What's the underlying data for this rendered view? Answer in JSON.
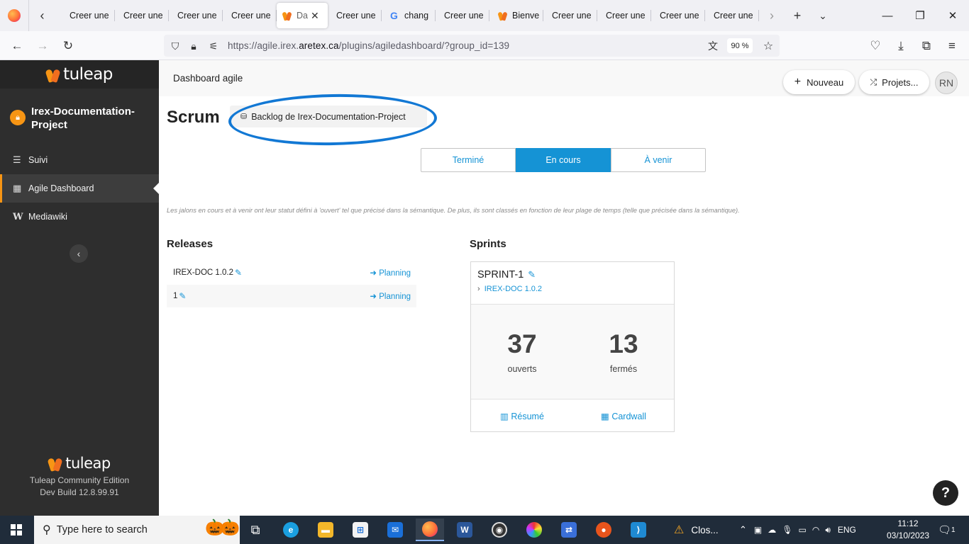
{
  "browser": {
    "tabs": [
      {
        "label": "Creer une",
        "favicon": "none"
      },
      {
        "label": "Creer une",
        "favicon": "none"
      },
      {
        "label": "Creer une",
        "favicon": "none"
      },
      {
        "label": "Creer une",
        "favicon": "none"
      },
      {
        "label": "Da",
        "favicon": "tuleap-icon",
        "active": true
      },
      {
        "label": "Creer une",
        "favicon": "none"
      },
      {
        "label": "chang",
        "favicon": "google-icon"
      },
      {
        "label": "Creer une",
        "favicon": "none"
      },
      {
        "label": "Bienve",
        "favicon": "tuleap-icon"
      },
      {
        "label": "Creer une",
        "favicon": "none"
      },
      {
        "label": "Creer une",
        "favicon": "none"
      },
      {
        "label": "Creer une",
        "favicon": "none"
      },
      {
        "label": "Creer une",
        "favicon": "none"
      }
    ],
    "url_prefix": "https://agile.irex.",
    "url_domain": "aretex.ca",
    "url_path": "/plugins/agiledashboard/?group_id=139",
    "zoom": "90 %"
  },
  "sidebar": {
    "logo_text": "tuleap",
    "project_name": "Irex-Documentation-Project",
    "items": [
      {
        "label": "Suivi",
        "icon": "list-icon"
      },
      {
        "label": "Agile Dashboard",
        "icon": "table-icon",
        "active": true
      },
      {
        "label": "Mediawiki",
        "icon": "wiki-icon"
      }
    ],
    "footer_logo": "tuleap",
    "edition": "Tuleap Community Edition",
    "build": "Dev Build 12.8.99.91"
  },
  "header": {
    "breadcrumb": "Dashboard agile",
    "new_button": "Nouveau",
    "projects_button": "Projets...",
    "avatar_initials": "RN"
  },
  "main": {
    "title": "Scrum",
    "backlog_button": "Backlog de Irex-Documentation-Project",
    "segments": [
      {
        "label": "Terminé"
      },
      {
        "label": "En cours",
        "active": true
      },
      {
        "label": "À venir"
      }
    ],
    "hint": "Les jalons en cours et à venir ont leur statut défini à 'ouvert' tel que précisé dans la sémantique. De plus, ils sont classés en fonction de leur plage de temps (telle que précisée dans la sémantique).",
    "releases_title": "Releases",
    "releases": [
      {
        "name": "IREX-DOC 1.0.2",
        "link": "Planning"
      },
      {
        "name": "1",
        "link": "Planning"
      }
    ],
    "sprints_title": "Sprints",
    "sprint": {
      "name": "SPRINT-1",
      "parent": "IREX-DOC 1.0.2",
      "open_count": "37",
      "open_label": "ouverts",
      "closed_count": "13",
      "closed_label": "fermés",
      "summary_link": "Résumé",
      "cardwall_link": "Cardwall"
    },
    "help": "?"
  },
  "taskbar": {
    "search_placeholder": "Type here to search",
    "app_label": "Clos...",
    "language": "ENG",
    "time": "11:12",
    "date": "03/10/2023",
    "notifications": "1"
  },
  "colors": {
    "accent": "#1593d5",
    "tuleap_orange": "#f79514",
    "sidebar_bg": "#2e2e2e",
    "highlight_oval": "#1278d4"
  }
}
